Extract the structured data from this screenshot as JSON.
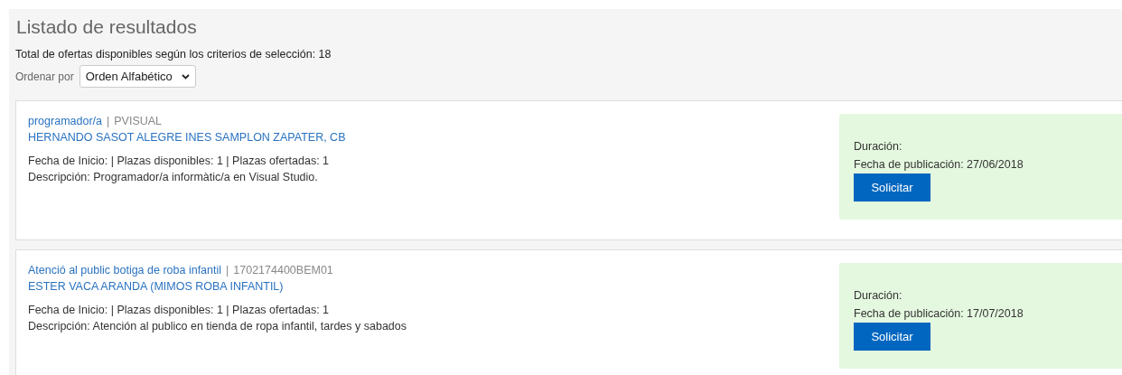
{
  "heading": "Listado de resultados",
  "total": "Total de ofertas disponibles según los criterios de selección: 18",
  "sort": {
    "label": "Ordenar por",
    "value": "Orden Alfabético"
  },
  "offers": [
    {
      "title": "programador/a",
      "separator": "|",
      "code": "PVISUAL",
      "company": "HERNANDO SASOT ALEGRE INES SAMPLON ZAPATER, CB",
      "meta": "Fecha de Inicio: | Plazas disponibles: 1 | Plazas ofertadas: 1",
      "description": "Descripción: Programador/a informàtic/a en Visual Studio.",
      "duration": "Duración:",
      "published": "Fecha de publicación: 27/06/2018",
      "button": "Solicitar"
    },
    {
      "title": "Atenció al public botiga de roba infantil",
      "separator": "|",
      "code": "1702174400BEM01",
      "company": "ESTER VACA ARANDA (MIMOS ROBA INFANTIL)",
      "meta": "Fecha de Inicio: | Plazas disponibles: 1 | Plazas ofertadas: 1",
      "description": "Descripción: Atención al publico en tienda de ropa infantil, tardes y sabados",
      "duration": "Duración:",
      "published": "Fecha de publicación: 17/07/2018",
      "button": "Solicitar"
    }
  ]
}
